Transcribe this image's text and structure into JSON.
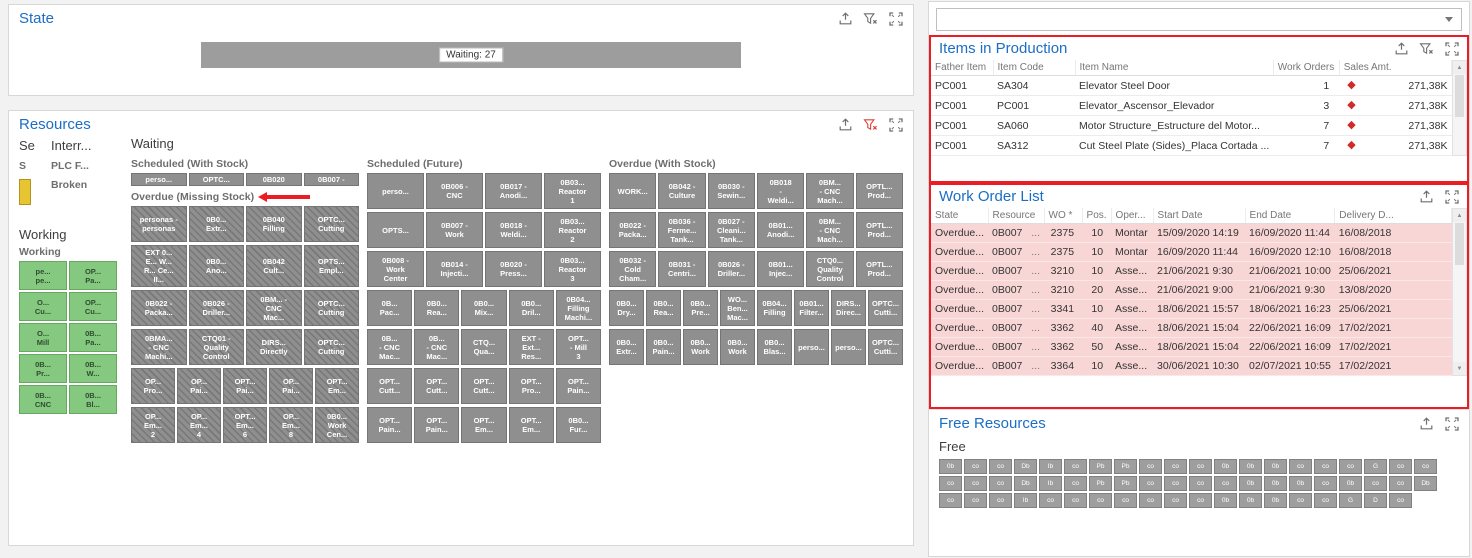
{
  "theme": {
    "title_blue": "#1b6ec6",
    "annotation_red": "#ec1c24",
    "overdue_row_bg": "#f8d6d6",
    "tile_gray": "#8f8f8f",
    "tile_green": "#85c87f",
    "diamond_red": "#d02a2a",
    "broken_yellow": "#e7c431"
  },
  "state_panel": {
    "title": "State",
    "bar_label": "Waiting: 27"
  },
  "resources_panel": {
    "title": "Resources",
    "setup_header": "Se",
    "setup_group": "S",
    "interrupted_header": "Interr...",
    "interrupted_groups": [
      "PLC F...",
      "Broken"
    ],
    "waiting_header": "Waiting",
    "working_header": "Working",
    "working": {
      "group_label": "Working",
      "tiles": [
        [
          "pe...",
          "pe..."
        ],
        [
          "OP...",
          "Pa..."
        ],
        [
          "O...",
          "Cu..."
        ],
        [
          "OP...",
          "Cu..."
        ],
        [
          "O...",
          "Mill"
        ],
        [
          "0B...",
          "Pa..."
        ],
        [
          "0B...",
          "Pr..."
        ],
        [
          "0B...",
          "W..."
        ],
        [
          "0B...",
          "CNC"
        ],
        [
          "0B...",
          "Bl..."
        ]
      ]
    },
    "waiting_groups": [
      {
        "label": "Scheduled (With Stock)",
        "short": true,
        "rows": [
          [
            [
              "perso..."
            ],
            [
              "OPTC..."
            ],
            [
              "0B020"
            ],
            [
              "0B007 -"
            ]
          ]
        ]
      },
      {
        "label": "Overdue (Missing Stock)",
        "annotated": true,
        "hatched": true,
        "rows": [
          [
            [
              "personas -",
              "personas"
            ],
            [
              "0B0...",
              "Extr..."
            ],
            [
              "0B040",
              "Filling"
            ],
            [
              "OPTC...",
              "Cutting"
            ]
          ],
          [
            [
              "EXT 0...",
              "E... W...",
              "R... Ce...",
              "II..."
            ],
            [
              "0B0...",
              "Ano..."
            ],
            [
              "0B042",
              "Cult..."
            ],
            [
              "OPTS...",
              "Empl..."
            ]
          ],
          [
            [
              "0B022 -",
              "Packa..."
            ],
            [
              "0B026 -",
              "Driller..."
            ],
            [
              "0BM... -",
              "CNC",
              "Mac..."
            ],
            [
              "OPTC...",
              "Cutting"
            ]
          ],
          [
            [
              "0BMA...",
              "- CNC",
              "Machi..."
            ],
            [
              "CTQ01 -",
              "Quality",
              "Control"
            ],
            [
              "DIRS...",
              "Directly"
            ],
            [
              "OPTC...",
              "Cutting"
            ]
          ],
          [
            [
              "OP...",
              "Pro..."
            ],
            [
              "OP...",
              "Pai..."
            ],
            [
              "OPT...",
              "Pai..."
            ],
            [
              "OP...",
              "Pai..."
            ],
            [
              "OPT...",
              "Em..."
            ]
          ],
          [
            [
              "OP...",
              "Em...",
              "2"
            ],
            [
              "OP...",
              "Em...",
              "4"
            ],
            [
              "OPT...",
              "Em...",
              "6"
            ],
            [
              "OP...",
              "Em...",
              "8"
            ],
            [
              "0B0...",
              "Work",
              "Cen..."
            ]
          ]
        ]
      },
      {
        "label": "Scheduled (Future)",
        "rows": [
          [
            [
              "perso..."
            ],
            [
              "0B006 -",
              "CNC"
            ],
            [
              "0B017 -",
              "Anodi..."
            ],
            [
              "0B03...",
              "Reactor",
              "1"
            ]
          ],
          [
            [
              "OPTS..."
            ],
            [
              "0B007 -",
              "Work"
            ],
            [
              "0B018 -",
              "Weldi..."
            ],
            [
              "0B03...",
              "Reactor",
              "2"
            ]
          ],
          [
            [
              "0B008 -",
              "Work",
              "Center"
            ],
            [
              "0B014 -",
              "Injecti..."
            ],
            [
              "0B020 -",
              "Press..."
            ],
            [
              "0B03...",
              "Reactor",
              "3"
            ]
          ],
          [
            [
              "0B...",
              "Pac..."
            ],
            [
              "0B0...",
              "Rea..."
            ],
            [
              "0B0...",
              "Mix..."
            ],
            [
              "0B0...",
              "Dril..."
            ],
            [
              "0B04...",
              "Filling",
              "Machi..."
            ]
          ],
          [
            [
              "0B...",
              "- CNC",
              "Mac..."
            ],
            [
              "0B...",
              "- CNC",
              "Mac..."
            ],
            [
              "CTQ...",
              "Qua..."
            ],
            [
              "EXT -",
              "Ext...",
              "Res..."
            ],
            [
              "OPT...",
              "- Mill",
              "3"
            ]
          ],
          [
            [
              "OPT...",
              "Cutt..."
            ],
            [
              "OPT...",
              "Cutt..."
            ],
            [
              "OPT...",
              "Cutt..."
            ],
            [
              "OPT...",
              "Pro..."
            ],
            [
              "OPT...",
              "Pain..."
            ]
          ],
          [
            [
              "OPT...",
              "Pain..."
            ],
            [
              "OPT...",
              "Pain..."
            ],
            [
              "OPT...",
              "Em..."
            ],
            [
              "OPT...",
              "Em..."
            ],
            [
              "0B0...",
              "Fur..."
            ]
          ]
        ]
      },
      {
        "label": "Overdue (With Stock)",
        "rows": [
          [
            [
              "WORK..."
            ],
            [
              "0B042 -",
              "Culture"
            ],
            [
              "0B030 -",
              "Sewin..."
            ],
            [
              "0B018",
              "-",
              "Weldi..."
            ],
            [
              "0BM...",
              "- CNC",
              "Mach..."
            ],
            [
              "OPTL...",
              "Prod..."
            ]
          ],
          [
            [
              "0B022 -",
              "Packa..."
            ],
            [
              "0B036 -",
              "Ferme...",
              "Tank..."
            ],
            [
              "0B027 -",
              "Cleani...",
              "Tank..."
            ],
            [
              "0B01...",
              "Anodi..."
            ],
            [
              "0BM...",
              "- CNC",
              "Mach..."
            ],
            [
              "OPTL...",
              "Prod..."
            ]
          ],
          [
            [
              "0B032 -",
              "Cold",
              "Cham..."
            ],
            [
              "0B031 -",
              "Centri..."
            ],
            [
              "0B026 -",
              "Driller..."
            ],
            [
              "0B01...",
              "Injec..."
            ],
            [
              "CTQ0...",
              "Quality",
              "Control"
            ],
            [
              "OPTL...",
              "Prod..."
            ]
          ],
          [
            [
              "0B0...",
              "Dry..."
            ],
            [
              "0B0...",
              "Rea..."
            ],
            [
              "0B0...",
              "Pre..."
            ],
            [
              "WO...",
              "Ben...",
              "Mac..."
            ],
            [
              "0B04...",
              "Filling"
            ],
            [
              "0B01...",
              "Filter..."
            ],
            [
              "DIRS...",
              "Direc..."
            ],
            [
              "OPTC...",
              "Cutti..."
            ]
          ],
          [
            [
              "0B0...",
              "Extr..."
            ],
            [
              "0B0...",
              "Pain..."
            ],
            [
              "0B0...",
              "Work"
            ],
            [
              "0B0...",
              "Work"
            ],
            [
              "0B0...",
              "Blas..."
            ],
            [
              "perso..."
            ],
            [
              "perso..."
            ],
            [
              "OPTC...",
              "Cutti..."
            ]
          ]
        ]
      }
    ]
  },
  "right": {
    "filter_dropdown": {
      "value": ""
    },
    "items_in_production": {
      "title": "Items in Production",
      "columns": [
        "Father Item",
        "Item Code",
        "Item Name",
        "Work Orders",
        "Sales Amt."
      ],
      "rows": [
        {
          "father_item": "PC001",
          "item_code": "SA304",
          "item_name": "Elevator Steel Door",
          "work_orders": "1",
          "sales_amt": "271,38K"
        },
        {
          "father_item": "PC001",
          "item_code": "PC001",
          "item_name": "Elevator_Ascensor_Elevador",
          "work_orders": "3",
          "sales_amt": "271,38K"
        },
        {
          "father_item": "PC001",
          "item_code": "SA060",
          "item_name": "Motor Structure_Estructure del Motor...",
          "work_orders": "7",
          "sales_amt": "271,38K"
        },
        {
          "father_item": "PC001",
          "item_code": "SA312",
          "item_name": "Cut Steel Plate (Sides)_Placa Cortada ...",
          "work_orders": "7",
          "sales_amt": "271,38K"
        }
      ]
    },
    "work_order_list": {
      "title": "Work Order List",
      "columns": [
        "State",
        "Resource",
        "WO *",
        "Pos.",
        "Oper...",
        "Start Date",
        "End Date",
        "Delivery D..."
      ],
      "rows": [
        {
          "state": "Overdue...",
          "resource": "0B007",
          "resource_more": "...",
          "wo": "2375",
          "pos": "10",
          "oper": "Montar",
          "start": "15/09/2020 14:19",
          "end": "16/09/2020 11:44",
          "delivery": "16/08/2018"
        },
        {
          "state": "Overdue...",
          "resource": "0B007",
          "resource_more": "...",
          "wo": "2375",
          "pos": "10",
          "oper": "Montar",
          "start": "16/09/2020 11:44",
          "end": "16/09/2020 12:10",
          "delivery": "16/08/2018"
        },
        {
          "state": "Overdue...",
          "resource": "0B007",
          "resource_more": "...",
          "wo": "3210",
          "pos": "10",
          "oper": "Asse...",
          "start": "21/06/2021 9:30",
          "end": "21/06/2021 10:00",
          "delivery": "25/06/2021"
        },
        {
          "state": "Overdue...",
          "resource": "0B007",
          "resource_more": "...",
          "wo": "3210",
          "pos": "20",
          "oper": "Asse...",
          "start": "21/06/2021 9:00",
          "end": "21/06/2021 9:30",
          "delivery": "13/08/2020"
        },
        {
          "state": "Overdue...",
          "resource": "0B007",
          "resource_more": "...",
          "wo": "3341",
          "pos": "10",
          "oper": "Asse...",
          "start": "18/06/2021 15:57",
          "end": "18/06/2021 16:23",
          "delivery": "25/06/2021"
        },
        {
          "state": "Overdue...",
          "resource": "0B007",
          "resource_more": "...",
          "wo": "3362",
          "pos": "40",
          "oper": "Asse...",
          "start": "18/06/2021 15:04",
          "end": "22/06/2021 16:09",
          "delivery": "17/02/2021"
        },
        {
          "state": "Overdue...",
          "resource": "0B007",
          "resource_more": "...",
          "wo": "3362",
          "pos": "50",
          "oper": "Asse...",
          "start": "18/06/2021 15:04",
          "end": "22/06/2021 16:09",
          "delivery": "17/02/2021"
        },
        {
          "state": "Overdue...",
          "resource": "0B007",
          "resource_more": "...",
          "wo": "3364",
          "pos": "10",
          "oper": "Asse...",
          "start": "30/06/2021 10:30",
          "end": "02/07/2021 10:55",
          "delivery": "17/02/2021"
        }
      ]
    },
    "free_resources": {
      "title": "Free Resources",
      "group_label": "Free",
      "tile_rows": [
        [
          "0b",
          "co",
          "co",
          "Db",
          "Ib",
          "co",
          "Pb",
          "Pb",
          "co",
          "co",
          "co",
          "0b",
          "0b",
          "0b",
          "co",
          "co",
          "co",
          "G",
          "co",
          "co"
        ],
        [
          "co",
          "co",
          "co",
          "Db",
          "Ib",
          "co",
          "Pb",
          "Pb",
          "co",
          "co",
          "co",
          "co",
          "0b",
          "0b",
          "0b",
          "co",
          "0b",
          "co",
          "co",
          "Db"
        ],
        [
          "co",
          "co",
          "co",
          "Ib",
          "co",
          "co",
          "co",
          "co",
          "co",
          "co",
          "co",
          "0b",
          "0b",
          "0b",
          "co",
          "co",
          "G",
          "D",
          "co"
        ]
      ]
    }
  }
}
